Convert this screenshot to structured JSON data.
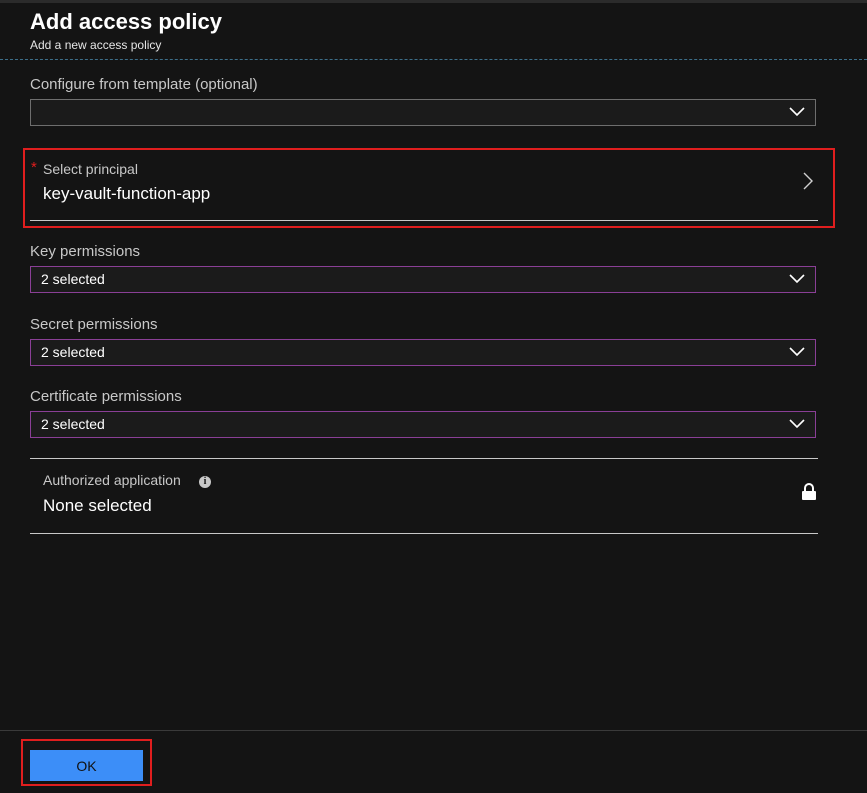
{
  "header": {
    "title": "Add access policy",
    "subtitle": "Add a new access policy"
  },
  "template": {
    "label": "Configure from template (optional)",
    "value": ""
  },
  "principal": {
    "required_marker": "*",
    "label": "Select principal",
    "value": "key-vault-function-app"
  },
  "key_permissions": {
    "label": "Key permissions",
    "value": "2 selected"
  },
  "secret_permissions": {
    "label": "Secret permissions",
    "value": "2 selected"
  },
  "certificate_permissions": {
    "label": "Certificate permissions",
    "value": "2 selected"
  },
  "authorized_application": {
    "label": "Authorized application",
    "info_icon": "i",
    "value": "None selected"
  },
  "footer": {
    "ok_label": "OK"
  },
  "icons": {
    "dropdown": "chevron-down-icon",
    "principal": "chevron-right-icon",
    "info": "info-icon",
    "lock": "lock-icon"
  },
  "colors": {
    "background": "#141414",
    "highlight": "#e01e1e",
    "permission_border": "#8a3f96",
    "ok_button": "#3c8ef8"
  }
}
